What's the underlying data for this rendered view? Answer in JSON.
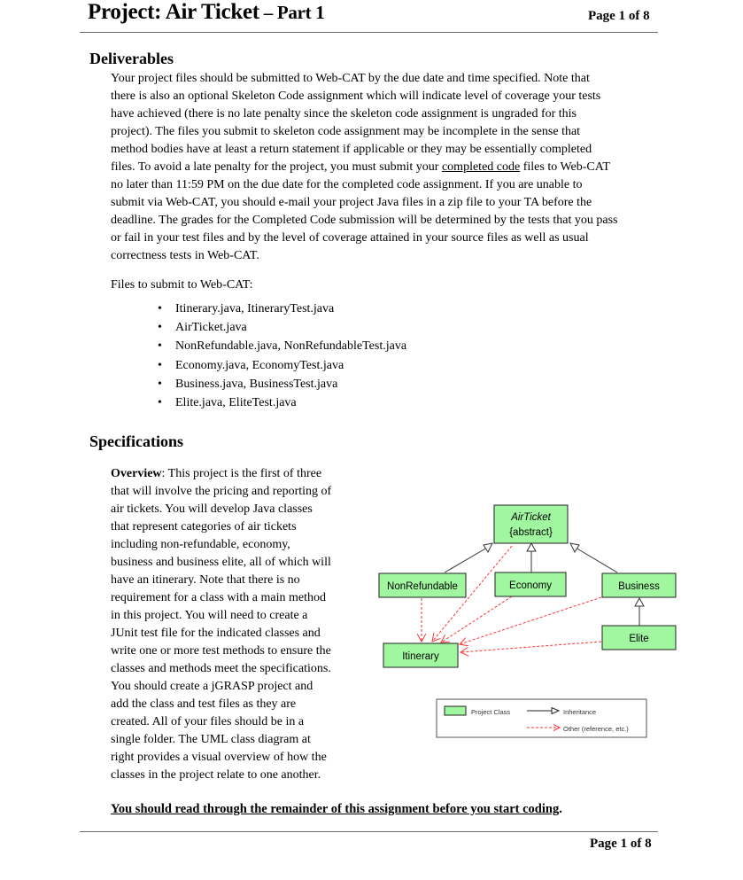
{
  "header": {
    "title_main": "Project: Air Ticket",
    "title_part": " – Part 1",
    "page_label": "Page 1 of 8"
  },
  "deliverables": {
    "heading": "Deliverables",
    "paragraph_lines": [
      "Your project files should be submitted to Web-CAT by the due date and time specified.  Note that",
      "there is also an optional Skeleton Code assignment which will indicate level of coverage your tests",
      "have achieved (there is no late penalty since the skeleton code assignment is ungraded for this",
      "project).  The files you submit to skeleton code assignment may be incomplete in the sense that",
      "method bodies have at least a return statement if applicable or they may be essentially completed"
    ],
    "line6_before": "files.  To avoid a late penalty for the project, you must submit your ",
    "line6_underlined": "completed code",
    "line6_after": " files to Web-CAT",
    "paragraph_lines_end": [
      "no later than 11:59 PM on the due date for the completed code assignment. If you are unable to",
      "submit via Web-CAT, you should e-mail your project Java files in a zip file to your TA before the",
      "deadline. The grades for the Completed Code submission will be determined by the tests that you pass",
      "or fail in your test files and by the level of coverage attained in your source files as well as usual",
      "correctness tests in Web-CAT."
    ],
    "files_intro": "Files to submit to Web-CAT:",
    "bullet_glyph": "•",
    "files": [
      "Itinerary.java, ItineraryTest.java",
      "AirTicket.java",
      "NonRefundable.java, NonRefundableTest.java",
      "Economy.java, EconomyTest.java",
      "Business.java, BusinessTest.java",
      "Elite.java, EliteTest.java"
    ]
  },
  "specifications": {
    "heading": "Specifications",
    "overview_label": "Overview",
    "overview_first_rest": ":  This project is the first of three",
    "overview_lines": [
      "that will involve the pricing and reporting of",
      "air tickets.  You will develop Java classes",
      "that represent categories of air tickets",
      "including non-refundable, economy,",
      "business and business elite, all of which will",
      "have an itinerary.  Note that there is no",
      "requirement for a class with a main method",
      "in this project. You will need to create a",
      "JUnit test file for the indicated classes and",
      "write one or more test methods to ensure the",
      "classes and methods meet the specifications.",
      "You should create a jGRASP project and",
      "add the class and test files as they are",
      "created.  All of your files should be in a",
      "single folder.  The UML class diagram at",
      "right provides a visual overview of how the",
      "classes in the project relate to one another."
    ]
  },
  "uml": {
    "class_fill": "#a0f7a0",
    "ref_color": "#ff3333",
    "classes": {
      "airticket": {
        "name": "AirTicket",
        "stereotype": "{abstract}"
      },
      "nonrefundable": {
        "name": "NonRefundable"
      },
      "economy": {
        "name": "Economy"
      },
      "business": {
        "name": "Business"
      },
      "elite": {
        "name": "Elite"
      },
      "itinerary": {
        "name": "Itinerary"
      }
    },
    "inheritance": [
      [
        "NonRefundable",
        "AirTicket"
      ],
      [
        "Economy",
        "AirTicket"
      ],
      [
        "Business",
        "AirTicket"
      ],
      [
        "Elite",
        "Business"
      ]
    ],
    "references": [
      [
        "AirTicket",
        "Itinerary"
      ],
      [
        "NonRefundable",
        "Itinerary"
      ],
      [
        "Economy",
        "Itinerary"
      ],
      [
        "Business",
        "Itinerary"
      ],
      [
        "Elite",
        "Itinerary"
      ]
    ],
    "legend": {
      "project_class": "Project Class",
      "inheritance": "Inheritance",
      "other": "Other (reference, etc.)"
    }
  },
  "closing": {
    "text": "You should read through the remainder of this assignment before you start coding",
    "period": "."
  },
  "footer": {
    "page_label": "Page 1 of 8"
  }
}
